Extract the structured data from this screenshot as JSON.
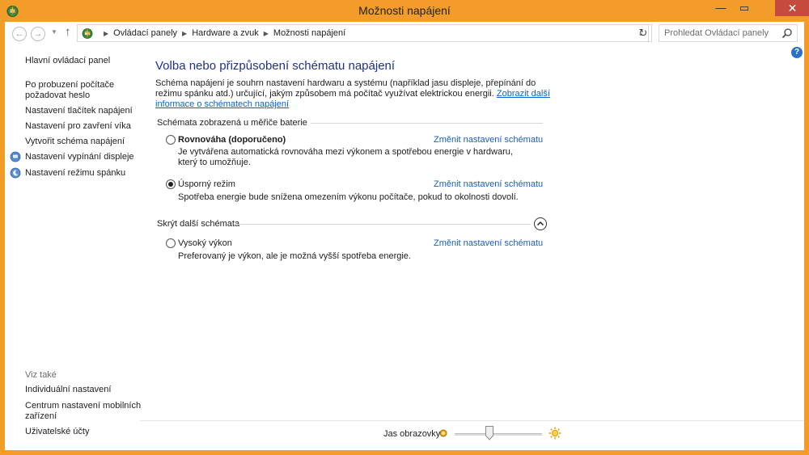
{
  "window": {
    "title": "Možnosti napájení"
  },
  "nav": {
    "breadcrumbs": [
      "Ovládací panely",
      "Hardware a zvuk",
      "Možnosti napájení"
    ],
    "search_placeholder": "Prohledat Ovládací panely"
  },
  "sidebar": {
    "items": [
      "Hlavní ovládací panel",
      "Po probuzení počítače požadovat heslo",
      "Nastavení tlačítek napájení",
      "Nastavení pro zavření víka",
      "Vytvořit schéma napájení",
      "Nastavení vypínání displeje",
      "Nastavení režimu spánku"
    ],
    "see_also_label": "Viz také",
    "see_also_items": [
      "Individuální nastavení",
      "Centrum nastavení mobilních zařízení",
      "Uživatelské účty"
    ]
  },
  "main": {
    "title": "Volba nebo přizpůsobení schématu napájení",
    "description": "Schéma napájení je souhrn nastavení hardwaru a systému (například jasu displeje, přepínání do režimu spánku atd.) určující, jakým způsobem má počítač využívat elektrickou energii.",
    "description_link": "Zobrazit další informace o schématech napájení",
    "group_battery": "Schémata zobrazená u měřiče baterie",
    "group_hidden": "Skrýt další schémata",
    "change_label": "Změnit nastavení schématu",
    "plans": [
      {
        "name": "Rovnováha (doporučeno)",
        "description": "Je vytvářena automatická rovnováha mezi výkonem a spotřebou energie v hardwaru, který to umožňuje.",
        "selected": false
      },
      {
        "name": "Úsporný režim",
        "description": "Spotřeba energie bude snížena omezením výkonu počítače, pokud to okolnosti dovolí.",
        "selected": true
      },
      {
        "name": "Vysoký výkon",
        "description": "Preferovaný je výkon, ale je možná vyšší spotřeba energie.",
        "selected": false
      }
    ]
  },
  "brightness": {
    "label": "Jas obrazovky:",
    "level_fraction": 0.4
  },
  "colors": {
    "frame": "#f39c2a",
    "close": "#c74b3d",
    "title_blue": "#1e3287",
    "link_blue": "#1a5fb4"
  },
  "icons": [
    "app-icon",
    "back-arrow-icon",
    "forward-arrow-icon",
    "up-arrow-icon",
    "refresh-icon",
    "search-icon",
    "help-icon",
    "display-icon",
    "moon-icon",
    "sun-icon",
    "chevron-up-icon"
  ]
}
